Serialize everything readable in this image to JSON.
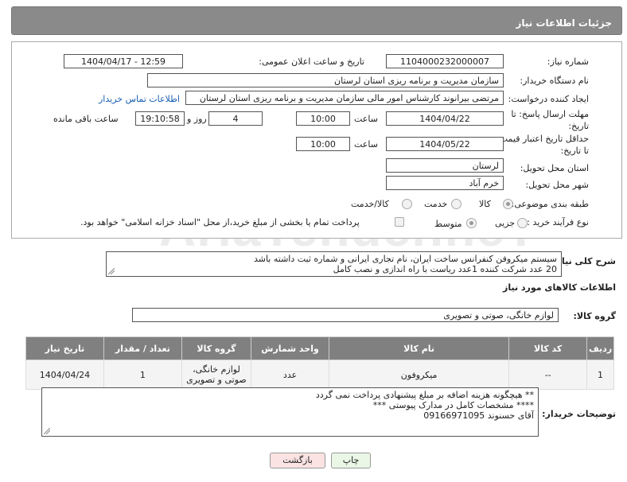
{
  "header": {
    "title": "جزئیات اطلاعات نیاز"
  },
  "watermark": {
    "text": "AriaTender.neT"
  },
  "form": {
    "need_number_label": "شماره نیاز:",
    "need_number": "1104000232000007",
    "announce_label": "تاریخ و ساعت اعلان عمومی:",
    "announce_value": "1404/04/17 - 12:59",
    "buyer_org_label": "نام دستگاه خریدار:",
    "buyer_org": "سازمان مدیریت و برنامه ریزی استان لرستان",
    "requester_label": "ایجاد کننده درخواست:",
    "requester": "مرتضی بیرانوند کارشناس امور مالی سازمان مدیریت و برنامه ریزی استان لرستان",
    "contact_link": "اطلاعات تماس خریدار",
    "deadline_label_1": "مهلت ارسال پاسخ: تا",
    "deadline_label_2": "تاریخ:",
    "deadline_date": "1404/04/22",
    "time_label": "ساعت",
    "deadline_time": "10:00",
    "days_value": "4",
    "days_label": "روز و",
    "remaining_time": "19:10:58",
    "remaining_label": "ساعت باقی مانده",
    "validity_label_1": "حداقل تاریخ اعتبار قیمت:",
    "validity_label_2": "تا تاریخ:",
    "validity_date": "1404/05/22",
    "validity_time": "10:00",
    "province_label": "استان محل تحویل:",
    "province": "لرستان",
    "city_label": "شهر محل تحویل:",
    "city": "خرم آباد",
    "category_label": "طبقه بندی موضوعی:",
    "category_options": [
      "کالا",
      "خدمت",
      "کالا/خدمت"
    ],
    "category_selected": "کالا",
    "process_label": "نوع فرآیند خرید :",
    "process_options": [
      "جزیی",
      "متوسط"
    ],
    "process_selected": "متوسط",
    "payment_note": "پرداخت تمام یا بخشی از مبلغ خرید،از محل \"اسناد خزانه اسلامی\" خواهد بود."
  },
  "description": {
    "label": "شرح کلی نیاز:",
    "line1": "سیستم میکروفن کنفرانس ساخت ایران، نام تجاری ایرانی و شماره ثبت داشته باشد",
    "line2": "20 عدد شرکت کننده 1عدد ریاست با راه اندازی و نصب کامل"
  },
  "goods_section": {
    "title": "اطلاعات کالاهای مورد نیاز",
    "group_label": "گروه کالا:",
    "group_value": "لوازم خانگی، صوتی و تصویری"
  },
  "table": {
    "headers": [
      "ردیف",
      "کد کالا",
      "نام کالا",
      "واحد شمارش",
      "گروه کالا",
      "تعداد / مقدار",
      "تاریخ نیاز"
    ],
    "rows": [
      {
        "row": "1",
        "code": "--",
        "name": "میکروفون",
        "unit": "عدد",
        "group_line1": "لوازم خانگی،",
        "group_line2": "صوتی و تصویری",
        "qty": "1",
        "date": "1404/04/24"
      }
    ]
  },
  "buyer_notes": {
    "label": "توضیحات خریدار:",
    "line1": "** هیچگونه هزینه اضافه بر مبلغ پیشنهادی پرداخت نمی گردد",
    "line2": "**** مشخصات کامل در مدارک پیوستی ***",
    "line3": "آقای حسنوند 09166971095"
  },
  "buttons": {
    "print": "چاپ",
    "back": "بازگشت"
  }
}
